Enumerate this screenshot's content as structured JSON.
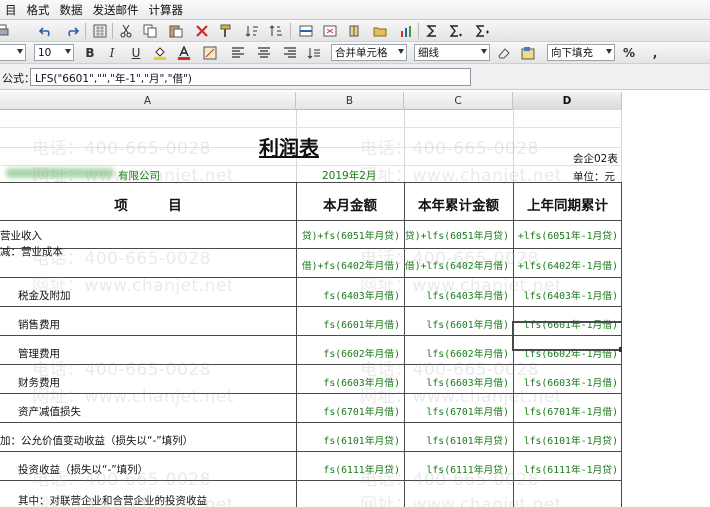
{
  "menu": [
    "目",
    "格式",
    "数据",
    "发送邮件",
    "计算器"
  ],
  "toolbar": {
    "font_size": "10",
    "merge_label": "合并单元格",
    "border_label": "细线",
    "fill_label": "向下填充",
    "percent": "%",
    "comma": ","
  },
  "formula_bar": {
    "label": "公式：",
    "value": "LFS(\"6601\",\"\",\"年-1\",\"月\",\"借\")"
  },
  "columns": [
    "A",
    "B",
    "C",
    "D"
  ],
  "sheet": {
    "title": "利润表",
    "form_code": "会企02表",
    "unit": "单位：元",
    "company": "有限公司",
    "period": "2019年2月",
    "headers": [
      "项　　　目",
      "本月金额",
      "本年累计金额",
      "上年同期累计"
    ],
    "rows": [
      {
        "item": "营业收入",
        "month": "贷)+fs(6051年月贷)",
        "ytd": "贷)+lfs(6051年月贷)",
        "prior": "+lfs(6051年-1月贷)"
      },
      {
        "item": "减：营业成本",
        "month": "借)+fs(6402年月借)",
        "ytd": "借)+lfs(6402年月借)",
        "prior": "+lfs(6402年-1月借)"
      },
      {
        "item": "税金及附加",
        "month": "fs(6403年月借)",
        "ytd": "lfs(6403年月借)",
        "prior": "lfs(6403年-1月借)"
      },
      {
        "item": "销售费用",
        "month": "fs(6601年月借)",
        "ytd": "lfs(6601年月借)",
        "prior": "lfs(6601年-1月借)"
      },
      {
        "item": "管理费用",
        "month": "fs(6602年月借)",
        "ytd": "lfs(6602年月借)",
        "prior": "lfs(6602年-1月借)"
      },
      {
        "item": "财务费用",
        "month": "fs(6603年月借)",
        "ytd": "lfs(6603年月借)",
        "prior": "lfs(6603年-1月借)"
      },
      {
        "item": "资产减值损失",
        "month": "fs(6701年月借)",
        "ytd": "lfs(6701年月借)",
        "prior": "lfs(6701年-1月借)"
      },
      {
        "item": "加：公允价值变动收益（损失以“-”填列）",
        "month": "fs(6101年月贷)",
        "ytd": "lfs(6101年月贷)",
        "prior": "lfs(6101年-1月贷)"
      },
      {
        "item": "投资收益（损失以“-”填列）",
        "month": "fs(6111年月贷)",
        "ytd": "lfs(6111年月贷)",
        "prior": "lfs(6111年-1月贷)"
      },
      {
        "item": "其中：对联营企业和合营企业的投资收益",
        "month": "",
        "ytd": "",
        "prior": ""
      }
    ]
  },
  "watermarks": {
    "phone": "电话：400-665-0028",
    "site": "网址：www.chanjet.net"
  },
  "colors": {
    "formula_text": "#1a7a1a",
    "grid_border": "#4a4a4a"
  }
}
